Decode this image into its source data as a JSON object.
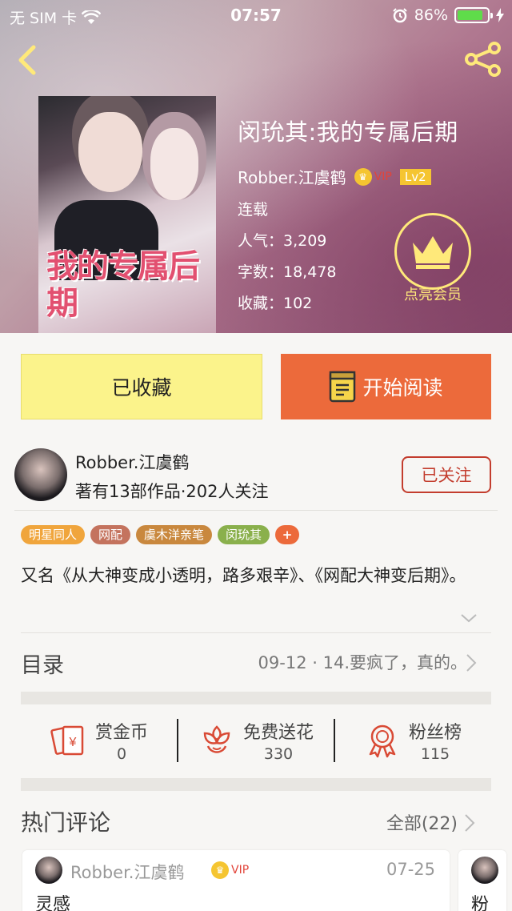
{
  "status_bar": {
    "carrier": "无 SIM 卡",
    "time": "07:57",
    "battery": "86%",
    "battery_level": 0.86
  },
  "book": {
    "title": "闵玧其:我的专属后期",
    "author": "Robber.江虞鹤",
    "vip_label": "VIP",
    "level": "Lv2",
    "status": "连载",
    "popularity": "人气：3,209",
    "word_count": "字数：18,478",
    "favorites": "收藏：102",
    "cover_title": "我的专属后期"
  },
  "member": {
    "label": "点亮会员",
    "color": "#ffe97a"
  },
  "actions": {
    "collect_label": "已收藏",
    "read_label": "开始阅读"
  },
  "author_card": {
    "name": "Robber.江虞鹤",
    "stats": "著有13部作品·202人关注",
    "follow_label": "已关注"
  },
  "tags": [
    {
      "label": "明星同人",
      "color": "#f0a53c"
    },
    {
      "label": "网配",
      "color": "#c4735e"
    },
    {
      "label": "虞木洋亲笔",
      "color": "#c9883e"
    },
    {
      "label": "闵玧其",
      "color": "#8ab04c"
    },
    {
      "label": "+",
      "color": "#ec6a3b"
    }
  ],
  "description": "又名《从大神变成小透明，路多艰辛》、《网配大神变后期》。",
  "catalog": {
    "label": "目录",
    "latest": "09-12 · 14.要疯了，真的。"
  },
  "rewards": [
    {
      "label": "赏金币",
      "value": "0",
      "icon": "red-envelope-icon"
    },
    {
      "label": "免费送花",
      "value": "330",
      "icon": "flower-icon"
    },
    {
      "label": "粉丝榜",
      "value": "115",
      "icon": "medal-icon"
    }
  ],
  "comments": {
    "label": "热门评论",
    "all": "全部(22)",
    "items": [
      {
        "name": "Robber.江虞鹤",
        "vip": "VIP",
        "date": "07-25",
        "text": "灵感"
      },
      {
        "text": "粉"
      }
    ]
  },
  "colors": {
    "accent": "#ec6a3b",
    "collect": "#fbf38b",
    "follow": "#c33d2e"
  }
}
